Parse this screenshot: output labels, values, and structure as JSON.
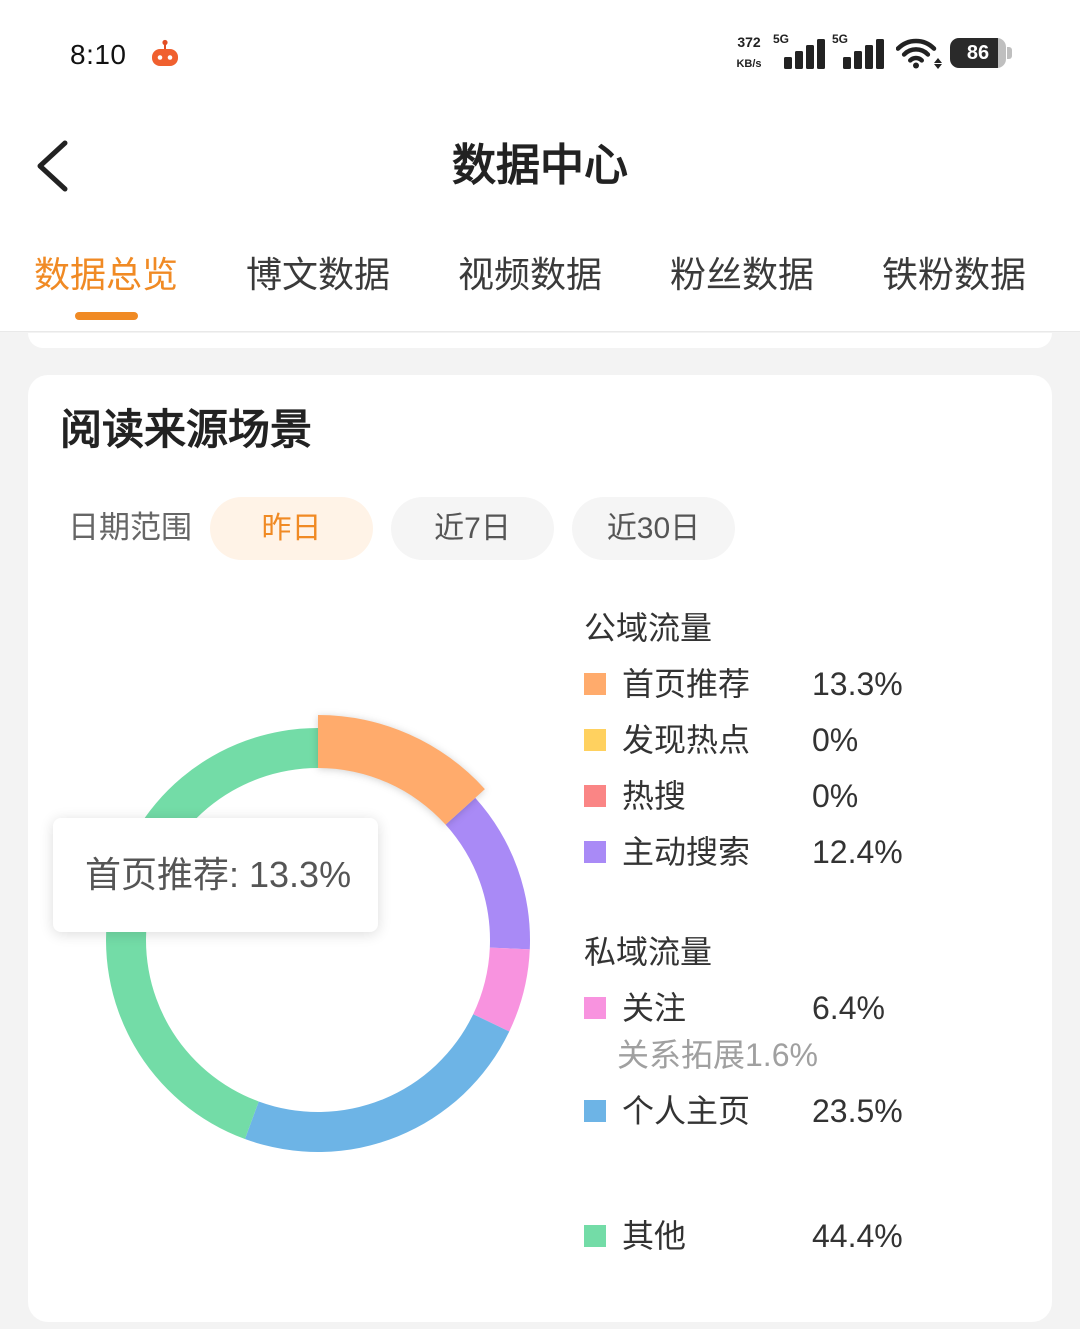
{
  "status_bar": {
    "time": "8:10",
    "app_icon": "robot-icon",
    "net_speed": "372",
    "net_speed_unit": "KB/s",
    "network_1": "5G",
    "network_2": "5G",
    "signal_icon": "signal-bars-icon",
    "wifi_icon": "wifi-icon",
    "battery": "86"
  },
  "header": {
    "back_icon": "chevron-left-icon",
    "title": "数据中心"
  },
  "tabs": [
    {
      "label": "数据总览",
      "active": true
    },
    {
      "label": "博文数据",
      "active": false
    },
    {
      "label": "视频数据",
      "active": false
    },
    {
      "label": "粉丝数据",
      "active": false
    },
    {
      "label": "铁粉数据",
      "active": false
    }
  ],
  "section": {
    "title": "阅读来源场景"
  },
  "date_range": {
    "label": "日期范围",
    "options": [
      {
        "label": "昨日",
        "active": true
      },
      {
        "label": "近7日",
        "active": false
      },
      {
        "label": "近30日",
        "active": false
      }
    ]
  },
  "theme": {
    "accent": "#F08A24",
    "accent_soft": "#FFF3E7"
  },
  "chart_data": {
    "type": "pie",
    "donut": true,
    "tooltip": "首页推荐: 13.3%",
    "groups": [
      {
        "name": "公域流量",
        "items": [
          {
            "name": "首页推荐",
            "value": 13.3,
            "label": "13.3%",
            "color": "#FFAB6C",
            "highlighted": true
          },
          {
            "name": "发现热点",
            "value": 0,
            "label": "0%",
            "color": "#FFD15F"
          },
          {
            "name": "热搜",
            "value": 0,
            "label": "0%",
            "color": "#FA8585"
          },
          {
            "name": "主动搜索",
            "value": 12.4,
            "label": "12.4%",
            "color": "#A98AF6"
          }
        ]
      },
      {
        "name": "私域流量",
        "items": [
          {
            "name": "关注",
            "value": 6.4,
            "label": "6.4%",
            "color": "#F893DF",
            "sub_label": "关系拓展1.6%"
          },
          {
            "name": "个人主页",
            "value": 23.5,
            "label": "23.5%",
            "color": "#6DB4E6"
          }
        ]
      },
      {
        "items": [
          {
            "name": "其他",
            "value": 44.4,
            "label": "44.4%",
            "color": "#73DCA7"
          }
        ]
      }
    ]
  }
}
